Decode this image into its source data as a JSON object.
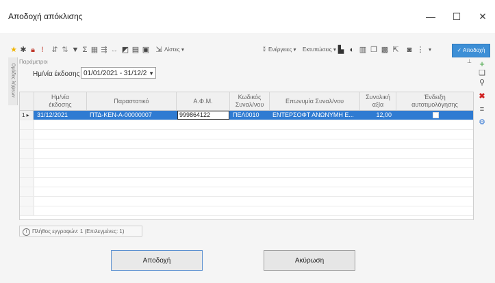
{
  "window": {
    "title": "Αποδοχή απόκλισης",
    "minimize": "—",
    "maximize": "☐",
    "close": "✕"
  },
  "toolbar": {
    "lists": "Λίστες ▾",
    "actions": "Ενέργειες ▾",
    "prints": "Εκτυπώσεις ▾",
    "accept": "✓ Αποδοχή"
  },
  "sidetab": {
    "label": "Ομάδες λήψεων"
  },
  "params": {
    "header": "Παράμετροι",
    "date_label": "Ημ/νία έκδοσης",
    "date_value": "01/01/2021 - 31/12/2"
  },
  "table": {
    "columns": [
      "Ημ/νία\nέκδοσης",
      "Παραστατικό",
      "Α.Φ.Μ.",
      "Κωδικός\nΣυναλ/νου",
      "Επωνυμία Συναλ/νου",
      "Συνολική\nαξία",
      "Ένδειξη\nαυτοτιμολόγησης"
    ],
    "rows": [
      {
        "index": "1",
        "date": "31/12/2021",
        "doc": "ΠΤΔ-ΚΕΝ-Α-00000007",
        "afm": "999864122",
        "code": "ΠΕΛ0010",
        "name": "ΕΝΤΕΡΣΟΦΤ ΑΝΩΝΥΜΗ Ε...",
        "total": "12,00"
      }
    ]
  },
  "status": {
    "text": "Πλήθος εγγραφών: 1 (Επιλεγμένες: 1)"
  },
  "buttons": {
    "accept": "Αποδοχή",
    "cancel": "Ακύρωση"
  },
  "colors": {
    "accent": "#3d8fd6",
    "selected_row": "#2f7bd2"
  }
}
